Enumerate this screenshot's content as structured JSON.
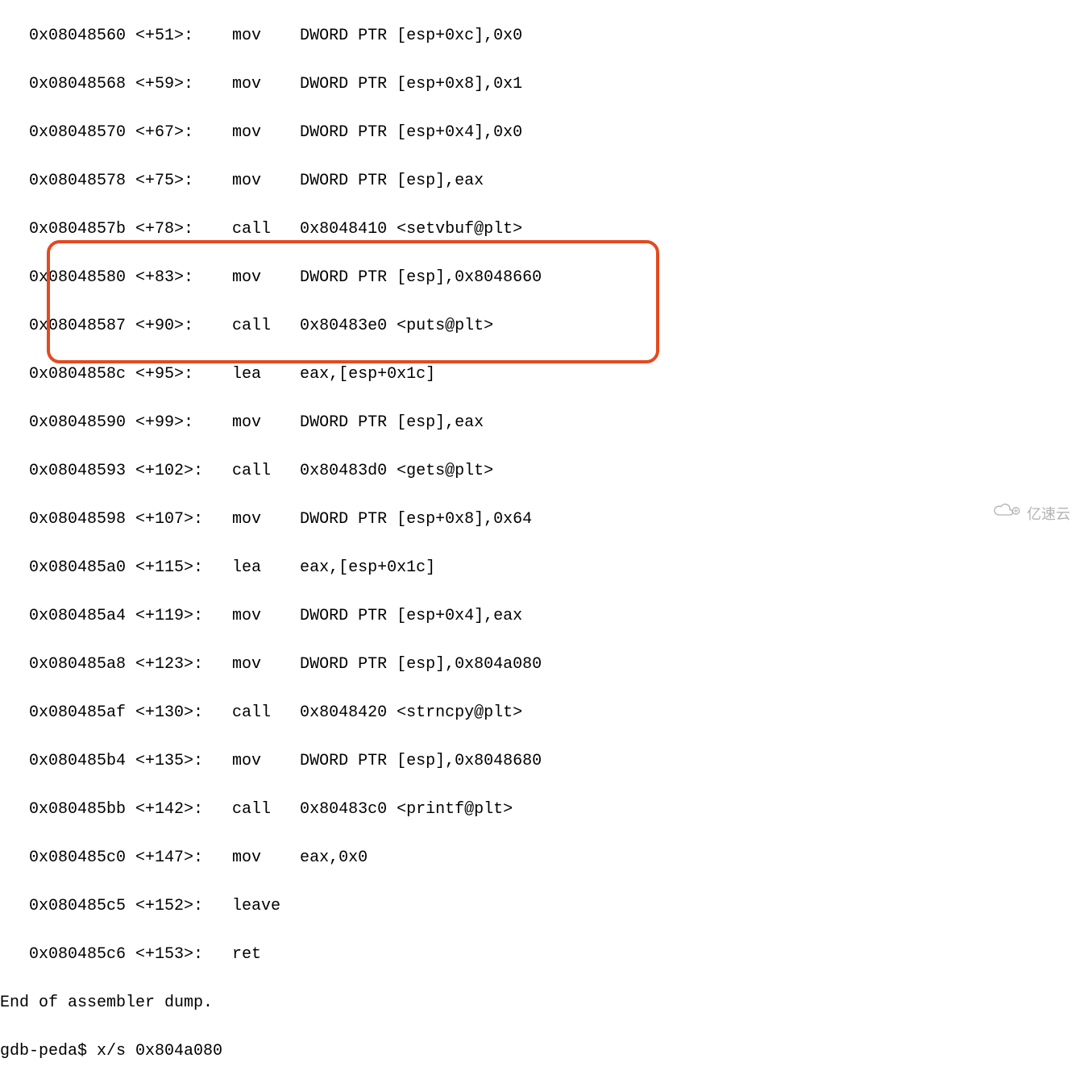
{
  "lines": {
    "l0": "   0x08048560 <+51>:    mov    DWORD PTR [esp+0xc],0x0",
    "l1": "   0x08048568 <+59>:    mov    DWORD PTR [esp+0x8],0x1",
    "l2": "   0x08048570 <+67>:    mov    DWORD PTR [esp+0x4],0x0",
    "l3": "   0x08048578 <+75>:    mov    DWORD PTR [esp],eax",
    "l4": "   0x0804857b <+78>:    call   0x8048410 <setvbuf@plt>",
    "l5": "   0x08048580 <+83>:    mov    DWORD PTR [esp],0x8048660",
    "l6": "   0x08048587 <+90>:    call   0x80483e0 <puts@plt>",
    "l7": "   0x0804858c <+95>:    lea    eax,[esp+0x1c]",
    "l8": "   0x08048590 <+99>:    mov    DWORD PTR [esp],eax",
    "l9": "   0x08048593 <+102>:   call   0x80483d0 <gets@plt>",
    "l10": "   0x08048598 <+107>:   mov    DWORD PTR [esp+0x8],0x64",
    "l11": "   0x080485a0 <+115>:   lea    eax,[esp+0x1c]",
    "l12": "   0x080485a4 <+119>:   mov    DWORD PTR [esp+0x4],eax",
    "l13": "   0x080485a8 <+123>:   mov    DWORD PTR [esp],0x804a080",
    "l14": "   0x080485af <+130>:   call   0x8048420 <strncpy@plt>",
    "l15": "   0x080485b4 <+135>:   mov    DWORD PTR [esp],0x8048680",
    "l16": "   0x080485bb <+142>:   call   0x80483c0 <printf@plt>",
    "l17": "   0x080485c0 <+147>:   mov    eax,0x0",
    "l18": "   0x080485c5 <+152>:   leave",
    "l19": "   0x080485c6 <+153>:   ret",
    "end": "End of assembler dump.",
    "prompt": "gdb-peda$ x/s 0x804a080"
  },
  "watermark": {
    "text": "亿速云"
  }
}
